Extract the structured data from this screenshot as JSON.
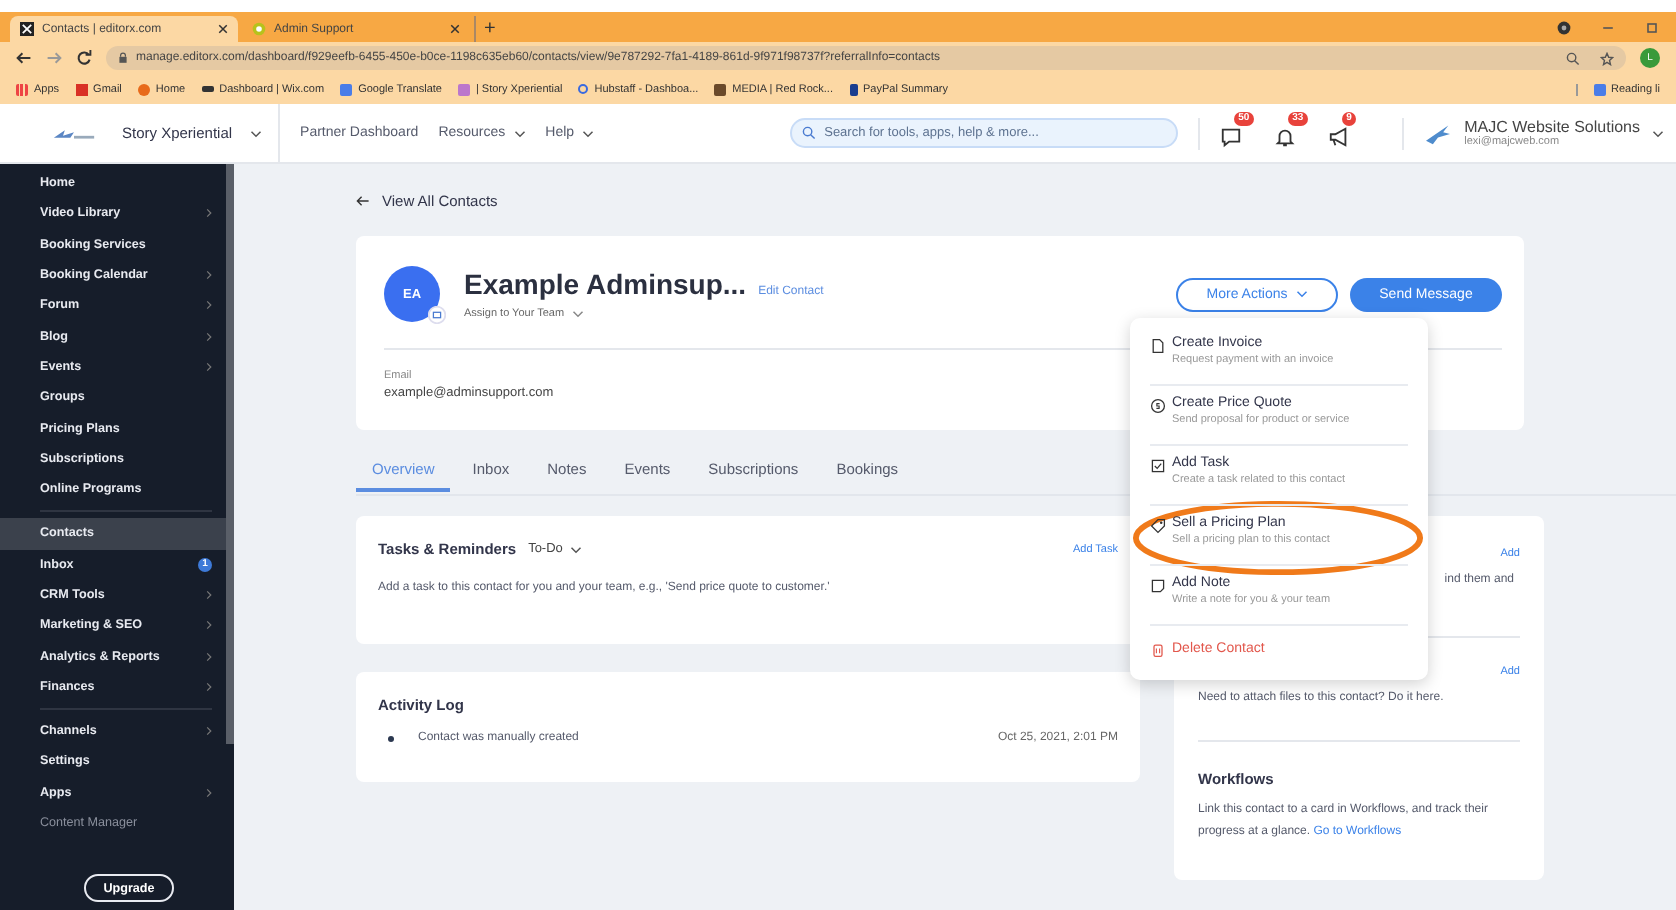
{
  "browser": {
    "tabs": [
      {
        "title": "Contacts | editorx.com",
        "selected": true
      },
      {
        "title": "Admin Support",
        "selected": false
      }
    ],
    "new_tab": "+",
    "url": "manage.editorx.com/dashboard/f929eefb-6455-450e-b0ce-1198c635eb60/contacts/view/9e787292-7fa1-4189-861d-9f971f98737f?referralInfo=contacts",
    "profile_initial": "L",
    "bookmarks": [
      "Apps",
      "Gmail",
      "Home",
      "Dashboard | Wix.com",
      "Google Translate",
      "| Story Xperiential",
      "Hubstaff - Dashboa...",
      "MEDIA | Red Rock...",
      "PayPal Summary"
    ],
    "reading_list": "Reading li"
  },
  "header": {
    "site": "Story Xperiential",
    "nav": [
      {
        "label": "Partner Dashboard",
        "has_menu": false
      },
      {
        "label": "Resources",
        "has_menu": true
      },
      {
        "label": "Help",
        "has_menu": true
      }
    ],
    "search": {
      "placeholder": "Search for tools, apps, help & more..."
    },
    "notifications": [
      {
        "kind": "chat",
        "count": "50"
      },
      {
        "kind": "bell",
        "count": "33"
      },
      {
        "kind": "megaphone",
        "count": "9"
      }
    ],
    "account": {
      "name": "MAJC Website Solutions",
      "email": "lexi@majcweb.com"
    }
  },
  "sidebar": {
    "sections": [
      [
        {
          "label": "Home",
          "has_submenu": false,
          "selected": false,
          "muted": false
        },
        {
          "label": "Video Library",
          "has_submenu": true,
          "selected": false,
          "muted": false
        },
        {
          "label": "Booking Services",
          "has_submenu": false,
          "selected": false,
          "muted": false
        },
        {
          "label": "Booking Calendar",
          "has_submenu": true,
          "selected": false,
          "muted": false
        },
        {
          "label": "Forum",
          "has_submenu": true,
          "selected": false,
          "muted": false
        },
        {
          "label": "Blog",
          "has_submenu": true,
          "selected": false,
          "muted": false
        },
        {
          "label": "Events",
          "has_submenu": true,
          "selected": false,
          "muted": false
        },
        {
          "label": "Groups",
          "has_submenu": false,
          "selected": false,
          "muted": false
        },
        {
          "label": "Pricing Plans",
          "has_submenu": false,
          "selected": false,
          "muted": false
        },
        {
          "label": "Subscriptions",
          "has_submenu": false,
          "selected": false,
          "muted": false
        },
        {
          "label": "Online Programs",
          "has_submenu": false,
          "selected": false,
          "muted": false
        }
      ],
      [
        {
          "label": "Contacts",
          "has_submenu": false,
          "selected": true,
          "muted": false
        },
        {
          "label": "Inbox",
          "has_submenu": false,
          "selected": false,
          "muted": false,
          "badge": "1"
        },
        {
          "label": "CRM Tools",
          "has_submenu": true,
          "selected": false,
          "muted": false
        },
        {
          "label": "Marketing & SEO",
          "has_submenu": true,
          "selected": false,
          "muted": false
        },
        {
          "label": "Analytics & Reports",
          "has_submenu": true,
          "selected": false,
          "muted": false
        },
        {
          "label": "Finances",
          "has_submenu": true,
          "selected": false,
          "muted": false
        }
      ],
      [
        {
          "label": "Channels",
          "has_submenu": true,
          "selected": false,
          "muted": false
        },
        {
          "label": "Settings",
          "has_submenu": false,
          "selected": false,
          "muted": false
        },
        {
          "label": "Apps",
          "has_submenu": true,
          "selected": false,
          "muted": false
        },
        {
          "label": "Content Manager",
          "has_submenu": false,
          "selected": false,
          "muted": true
        }
      ]
    ],
    "upgrade": "Upgrade"
  },
  "main": {
    "back_link": "View All Contacts",
    "contact": {
      "initials": "EA",
      "name": "Example Adminsup...",
      "edit": "Edit Contact",
      "assign": "Assign to Your Team",
      "email_label": "Email",
      "email": "example@adminsupport.com"
    },
    "actions": {
      "more": "More Actions",
      "send": "Send Message"
    },
    "tabs": [
      {
        "label": "Overview",
        "selected": true
      },
      {
        "label": "Inbox",
        "selected": false
      },
      {
        "label": "Notes",
        "selected": false
      },
      {
        "label": "Events",
        "selected": false
      },
      {
        "label": "Subscriptions",
        "selected": false
      },
      {
        "label": "Bookings",
        "selected": false
      }
    ],
    "tasks": {
      "title": "Tasks & Reminders",
      "filter": "To-Do",
      "add": "Add Task",
      "empty": "Add a task to this contact for you and your team, e.g., 'Send price quote to customer.'"
    },
    "activity": {
      "title": "Activity Log",
      "entries": [
        {
          "text": "Contact was manually created",
          "time": "Oct 25, 2021, 2:01 PM"
        }
      ]
    },
    "side": {
      "sections": [
        {
          "add": "Add",
          "text": "ind them and"
        },
        {
          "add": "Add",
          "text": "Need to attach files to this contact? Do it here."
        },
        {
          "title": "Workflows",
          "text": "Link this contact to a card in Workflows, and track their progress at a glance.",
          "link": "Go to Workflows"
        }
      ]
    },
    "menu": [
      {
        "title": "Create Invoice",
        "subtitle": "Request payment with an invoice",
        "danger": false,
        "highlighted": false
      },
      {
        "title": "Create Price Quote",
        "subtitle": "Send proposal for product or service",
        "danger": false,
        "highlighted": false
      },
      {
        "title": "Add Task",
        "subtitle": "Create a task related to this contact",
        "danger": false,
        "highlighted": false
      },
      {
        "title": "Sell a Pricing Plan",
        "subtitle": "Sell a pricing plan to this contact",
        "danger": false,
        "highlighted": true
      },
      {
        "title": "Add Note",
        "subtitle": "Write a note for you & your team",
        "danger": false,
        "highlighted": false
      },
      {
        "title": "Delete Contact",
        "danger": true,
        "highlighted": false
      }
    ]
  }
}
